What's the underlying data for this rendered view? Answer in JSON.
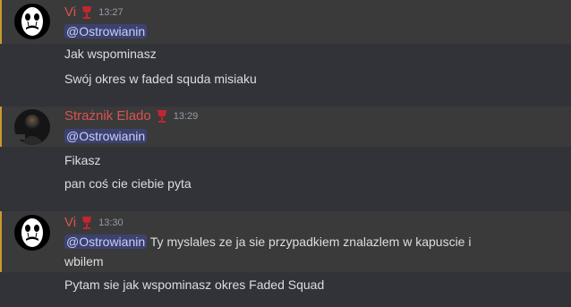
{
  "colors": {
    "background": "#323339",
    "message_highlight": "#3a3a3b",
    "highlight_bar": "#c99a2e",
    "author": "#d9534f",
    "mention_bg": "#3c4270",
    "mention_text": "#c9cdfb",
    "timestamp": "#949ba4",
    "text": "#dbdee1"
  },
  "messages": [
    {
      "author": "Vi",
      "role_icon": "red-goblet-icon",
      "avatar": "white-mask-face-avatar",
      "timestamp": "13:27",
      "mention": "@Ostrowianin",
      "lines": [
        "Jak wspominasz",
        "Swój okres w faded squda misiaku"
      ]
    },
    {
      "author": "Strażnik Elado",
      "role_icon": "red-goblet-icon",
      "avatar": "dark-photo-avatar",
      "timestamp": "13:29",
      "mention": "@Ostrowianin",
      "lines": [
        "Fikasz",
        "pan coś cie ciebie pyta"
      ]
    },
    {
      "author": "Vi",
      "role_icon": "red-goblet-icon",
      "avatar": "white-mask-face-avatar",
      "timestamp": "13:30",
      "mention": "@Ostrowianin",
      "mention_text": "Ty myslales ze ja sie przypadkiem znalazlem w kapuscie i",
      "lines": [
        "wbilem",
        "Pytam sie jak wspominasz okres Faded Squad"
      ]
    }
  ]
}
